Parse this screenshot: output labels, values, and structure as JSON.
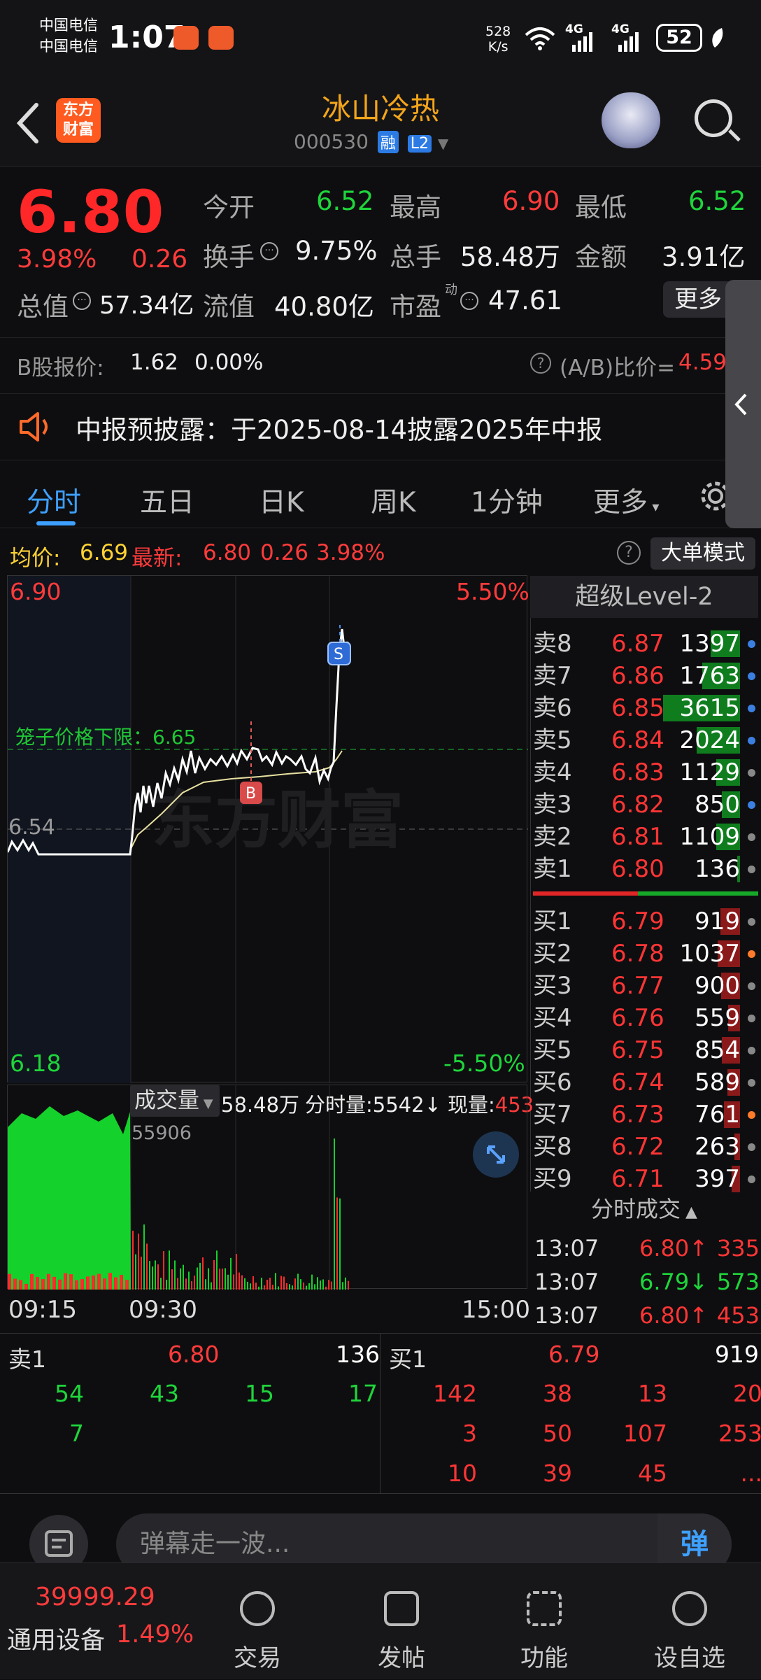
{
  "status_bar": {
    "carrier1": "中国电信",
    "carrier2": "中国电信",
    "time": "1:07",
    "net_speed_value": "528",
    "net_speed_unit": "K/s",
    "signal1": "4G",
    "signal2": "4G",
    "battery": "52"
  },
  "header": {
    "logo_line1": "东方",
    "logo_line2": "财富",
    "stock_name": "冰山冷热",
    "stock_code": "000530",
    "tag_margin": "融",
    "tag_level": "L2"
  },
  "quote": {
    "price": "6.80",
    "change_pct": "3.98%",
    "change_abs": "0.26",
    "open_label": "今开",
    "open": "6.52",
    "high_label": "最高",
    "high": "6.90",
    "low_label": "最低",
    "low": "6.52",
    "turnover_label": "换手",
    "turnover": "9.75%",
    "volume_label": "总手",
    "volume": "58.48万",
    "amount_label": "金额",
    "amount": "3.91亿",
    "mktcap_label": "总值",
    "mktcap": "57.34亿",
    "float_label": "流值",
    "float": "40.80亿",
    "pe_label": "市盈",
    "pe_sup": "动",
    "pe": "47.61",
    "more": "更多",
    "b_label": "B股报价:",
    "b_price": "1.62",
    "b_pct": "0.00%",
    "ab_label": "(A/B)比价=",
    "ab_value": "4.59"
  },
  "notice": "中报预披露：于2025-08-14披露2025年中报",
  "tabs": [
    "分时",
    "五日",
    "日K",
    "周K",
    "1分钟",
    "更多"
  ],
  "info": {
    "avg_label": "均价:",
    "avg": "6.69",
    "latest_label": "最新:",
    "latest": "6.80",
    "latest_chg": "0.26",
    "latest_pct": "3.98%",
    "bigorder": "大单模式"
  },
  "chart": {
    "top_price": "6.90",
    "bottom_price": "6.18",
    "mid_price": "6.54",
    "top_pct": "5.50%",
    "bottom_pct": "-5.50%",
    "cage_label": "笼子价格下限：6.65",
    "watermark": "东方财富",
    "marker_b": "B",
    "marker_s": "S"
  },
  "volume": {
    "selector": "成交量",
    "total": "58.48万",
    "period_label": "分时量:",
    "period": "5542↓",
    "current_label": "现量:",
    "current": "453",
    "peak": "55906",
    "t_start": "09:15",
    "t_open": "09:30",
    "t_end": "15:00"
  },
  "orderbook": {
    "title": "超级Level-2",
    "sells": [
      {
        "label": "卖8",
        "price": "6.87",
        "vol": "1397",
        "dot": "#3b7fe0"
      },
      {
        "label": "卖7",
        "price": "6.86",
        "vol": "1763",
        "dot": "#3b7fe0"
      },
      {
        "label": "卖6",
        "price": "6.85",
        "vol": "3615",
        "dot": "#3b7fe0"
      },
      {
        "label": "卖5",
        "price": "6.84",
        "vol": "2024",
        "dot": "#3b7fe0"
      },
      {
        "label": "卖4",
        "price": "6.83",
        "vol": "1129",
        "dot": "#888888"
      },
      {
        "label": "卖3",
        "price": "6.82",
        "vol": "850",
        "dot": "#3b7fe0"
      },
      {
        "label": "卖2",
        "price": "6.81",
        "vol": "1109",
        "dot": "#888888"
      },
      {
        "label": "卖1",
        "price": "6.80",
        "vol": "136",
        "dot": "#888888"
      }
    ],
    "buys": [
      {
        "label": "买1",
        "price": "6.79",
        "vol": "919",
        "dot": "#888888"
      },
      {
        "label": "买2",
        "price": "6.78",
        "vol": "1037",
        "dot": "#ff7a2a"
      },
      {
        "label": "买3",
        "price": "6.77",
        "vol": "900",
        "dot": "#888888"
      },
      {
        "label": "买4",
        "price": "6.76",
        "vol": "559",
        "dot": "#888888"
      },
      {
        "label": "买5",
        "price": "6.75",
        "vol": "854",
        "dot": "#888888"
      },
      {
        "label": "买6",
        "price": "6.74",
        "vol": "589",
        "dot": "#888888"
      },
      {
        "label": "买7",
        "price": "6.73",
        "vol": "761",
        "dot": "#ff7a2a"
      },
      {
        "label": "买8",
        "price": "6.72",
        "vol": "263",
        "dot": "#888888"
      },
      {
        "label": "买9",
        "price": "6.71",
        "vol": "397",
        "dot": "#888888"
      }
    ],
    "tick_title": "分时成交",
    "ticks": [
      {
        "time": "13:07",
        "price": "6.80↑",
        "vol": "335",
        "dir": "up"
      },
      {
        "time": "13:07",
        "price": "6.79↓",
        "vol": "573",
        "dir": "down"
      },
      {
        "time": "13:07",
        "price": "6.80↑",
        "vol": "453",
        "dir": "up"
      }
    ]
  },
  "depth": {
    "sell_label": "卖1",
    "sell_price": "6.80",
    "sell_total": "136",
    "buy_label": "买1",
    "buy_price": "6.79",
    "buy_total": "919",
    "sell_rows": [
      [
        "54",
        "43",
        "15",
        "17"
      ],
      [
        "7",
        "",
        "",
        ""
      ]
    ],
    "buy_rows": [
      [
        "142",
        "38",
        "13",
        "20"
      ],
      [
        "3",
        "50",
        "107",
        "253"
      ],
      [
        "10",
        "39",
        "45",
        "..."
      ]
    ]
  },
  "danmu": {
    "placeholder": "弹幕走一波...",
    "button": "弹"
  },
  "bottom_bar": {
    "index_value": "39999.29",
    "index_name": "通用设备",
    "index_pct": "1.49%",
    "items": [
      "交易",
      "发帖",
      "功能",
      "设自选"
    ]
  }
}
